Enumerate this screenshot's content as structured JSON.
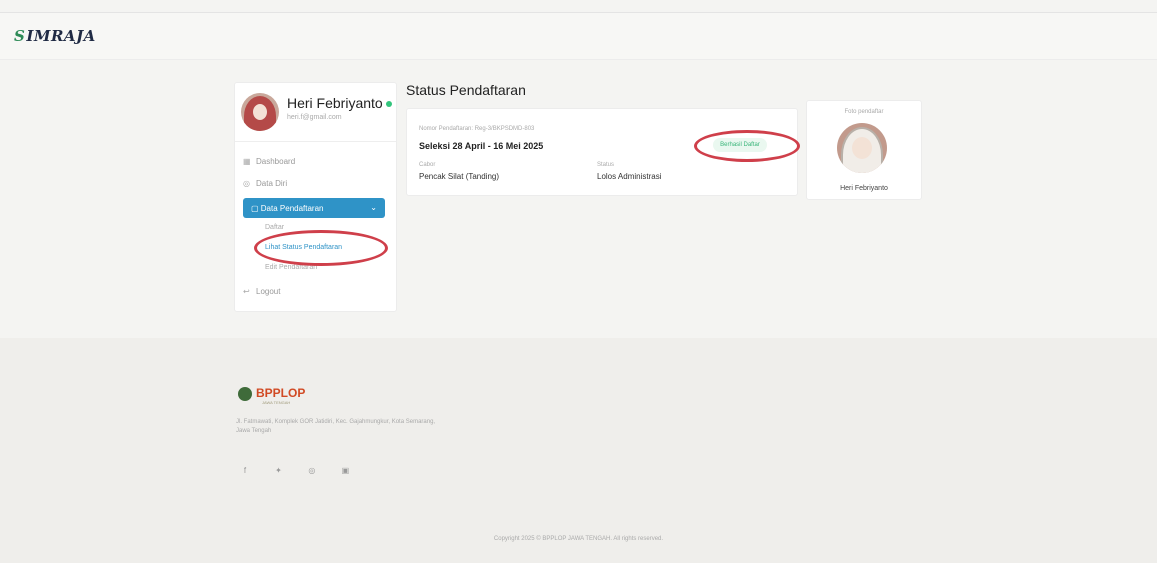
{
  "header": {
    "brand": "IMRAJA",
    "brand_mark": "S"
  },
  "user": {
    "name": "Heri Febriyanto",
    "email": "heri.f@gmail.com",
    "online_color": "#32c47c"
  },
  "sidebar": {
    "items": [
      {
        "label": "Dashboard",
        "icon": "grid-icon"
      },
      {
        "label": "Data Diri",
        "icon": "user-icon"
      }
    ],
    "active": {
      "label": "Data Pendaftaran",
      "icon": "folder-icon",
      "color": "#2f93c7"
    },
    "submenu": [
      "Daftar",
      "Lihat Status Pendaftaran",
      "Edit Pendaftaran"
    ],
    "logout": "Logout"
  },
  "main": {
    "title": "Status Pendaftaran",
    "registration": {
      "number": "Nomor Pendaftaran: Reg-3/BKPSDMD-803",
      "selection": "Seleksi 28 April - 16 Mei 2025",
      "category_label": "Cabor",
      "category_value": "Pencak Silat (Tanding)",
      "status_label": "Status",
      "status_value": "Lolos Administrasi",
      "badge": "Berhasil Daftar",
      "badge_color": "#37b478"
    },
    "photo": {
      "caption": "Foto pendaftar",
      "name": "Heri Febriyanto"
    }
  },
  "footer": {
    "logo": "BPPLOP",
    "logo_sub": "JAWA TENGAH",
    "address": "Jl. Fatmawati, Komplek GOR Jatidiri, Kec. Gajahmungkur, Kota Semarang, Jawa Tengah",
    "socials": [
      "facebook-icon",
      "twitter-icon",
      "instagram-icon",
      "youtube-icon"
    ],
    "copyright": "Copyright 2025 © BPPLOP JAWA TENGAH. All rights reserved."
  }
}
